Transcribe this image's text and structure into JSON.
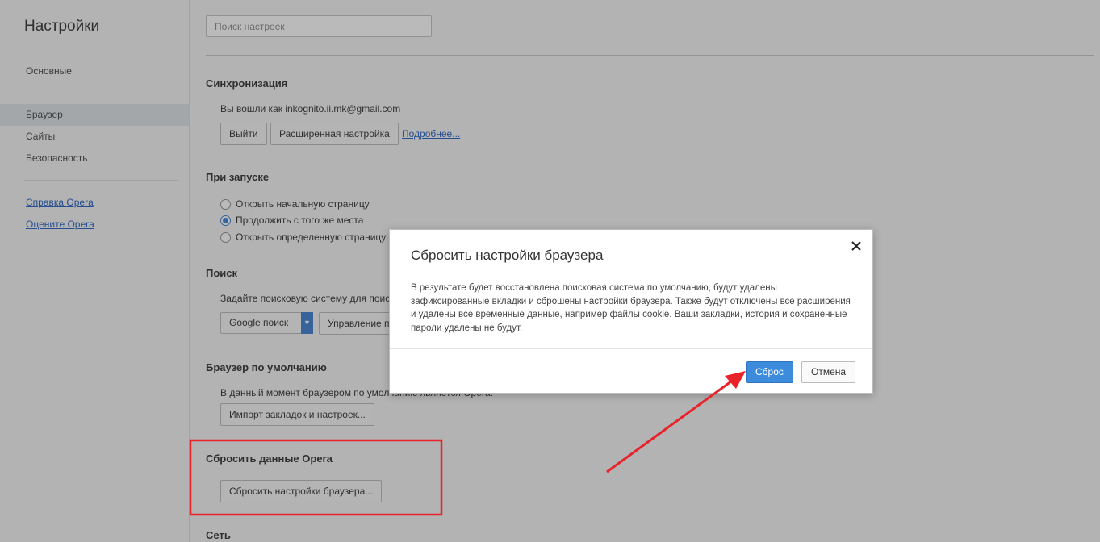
{
  "sidebar": {
    "title": "Настройки",
    "items": [
      {
        "label": "Основные"
      },
      {
        "label": "Браузер"
      },
      {
        "label": "Сайты"
      },
      {
        "label": "Безопасность"
      }
    ],
    "links": [
      {
        "label": "Справка Opera"
      },
      {
        "label": "Оцените Opera"
      }
    ]
  },
  "search": {
    "placeholder": "Поиск настроек"
  },
  "sync": {
    "title": "Синхронизация",
    "status": "Вы вошли как inkognito.ii.mk@gmail.com",
    "logout_button": "Выйти",
    "advanced_button": "Расширенная настройка",
    "more_link": "Подробнее..."
  },
  "startup": {
    "title": "При запуске",
    "options": [
      {
        "label": "Открыть начальную страницу",
        "checked": false
      },
      {
        "label": "Продолжить с того же места",
        "checked": true
      },
      {
        "label": "Открыть определенную страницу",
        "checked": false
      }
    ]
  },
  "search_engine": {
    "title": "Поиск",
    "description": "Задайте поисковую систему для поиск",
    "selected": "Google поиск",
    "manage_button": "Управление п"
  },
  "default_browser": {
    "title": "Браузер по умолчанию",
    "status": "В данный момент браузером по умолчанию является Opera.",
    "import_button": "Импорт закладок и настроек..."
  },
  "reset": {
    "title": "Сбросить данные Opera",
    "button": "Сбросить настройки браузера..."
  },
  "network": {
    "title": "Сеть"
  },
  "dialog": {
    "title": "Сбросить настройки браузера",
    "body": "В результате будет восстановлена поисковая система по умолчанию, будут удалены зафиксированные вкладки и сброшены настройки браузера. Также будут отключены все расширения и удалены все временные данные, например файлы cookie. Ваши закладки, история и сохраненные пароли удалены не будут.",
    "confirm_button": "Сброс",
    "cancel_button": "Отмена"
  },
  "colors": {
    "accent": "#3d8bdb",
    "annotation": "#e8232a",
    "link": "#2560c5"
  }
}
